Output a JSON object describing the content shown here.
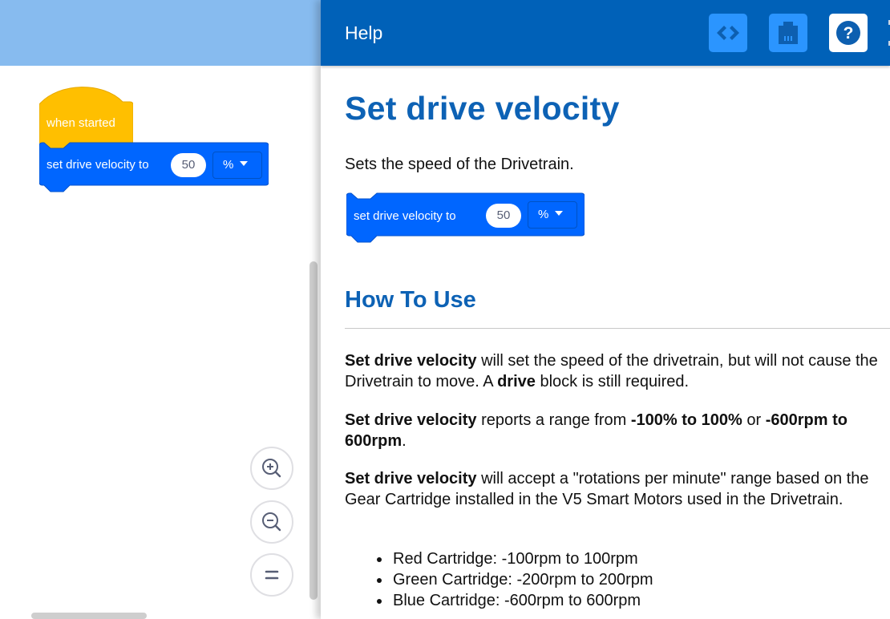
{
  "workspace": {
    "blocks": {
      "hat": {
        "label": "when started",
        "color": "#ffbf00"
      },
      "command": {
        "label": "set drive velocity to",
        "value": "50",
        "unit": "%",
        "color": "#0066ff"
      }
    },
    "zoom_controls": {
      "zoom_in": "zoom-in-icon",
      "zoom_out": "zoom-out-icon",
      "reset": "reset-zoom-icon"
    }
  },
  "help": {
    "header": {
      "title": "Help",
      "buttons": [
        {
          "name": "code-view",
          "icon": "code-brackets-icon"
        },
        {
          "name": "device-port",
          "icon": "port-icon"
        },
        {
          "name": "help",
          "icon": "question-icon",
          "active": true
        }
      ],
      "color": "#0061b8"
    },
    "title": "Set drive velocity",
    "intro": "Sets the speed of the Drivetrain.",
    "example_block": {
      "label": "set drive velocity to",
      "value": "50",
      "unit": "%"
    },
    "section_heading": "How To Use",
    "paragraphs": {
      "p1": {
        "b1": "Set drive velocity",
        "t1": " will set the speed of the drivetrain, but will not cause the Drivetrain to move. A ",
        "b2": "drive",
        "t2": " block is still required."
      },
      "p2": {
        "b1": "Set drive velocity",
        "t1": " reports a range from ",
        "b2": "-100% to 100%",
        "t2": " or ",
        "b3": "-600rpm to 600rpm",
        "t3": "."
      },
      "p3": {
        "b1": "Set drive velocity",
        "t1": " will accept a \"rotations per minute\" range based on the Gear Cartridge installed in the V5 Smart Motors used in the Drivetrain."
      }
    },
    "cartridges": [
      "Red Cartridge: -100rpm to 100rpm",
      "Green Cartridge: -200rpm to 200rpm",
      "Blue Cartridge: -600rpm to 600rpm"
    ]
  }
}
